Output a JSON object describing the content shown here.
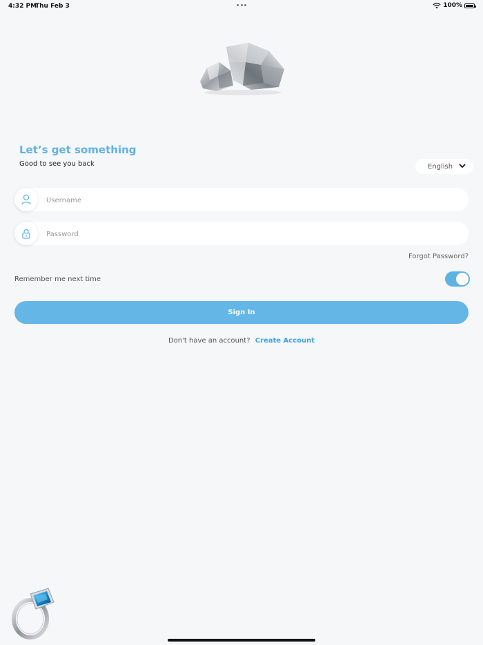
{
  "status_bar": {
    "time": "4:32 PM",
    "date": "Thu Feb 3",
    "battery": "100%"
  },
  "login": {
    "heading": "Let’s get something",
    "subheading": "Good to see you back",
    "language": "English",
    "username_placeholder": "Username",
    "password_placeholder": "Password",
    "forgot_password": "Forgot Password?",
    "remember_label": "Remember me next time",
    "remember_enabled": true,
    "sign_in": "Sign In",
    "no_account": "Don't have an account?",
    "create_account": "Create Account"
  },
  "colors": {
    "accent": "#5fb3e3",
    "background": "#f5f7f9"
  },
  "icons": [
    "wifi-icon",
    "battery-icon",
    "user-icon",
    "lock-icon",
    "chevron-down-icon"
  ]
}
